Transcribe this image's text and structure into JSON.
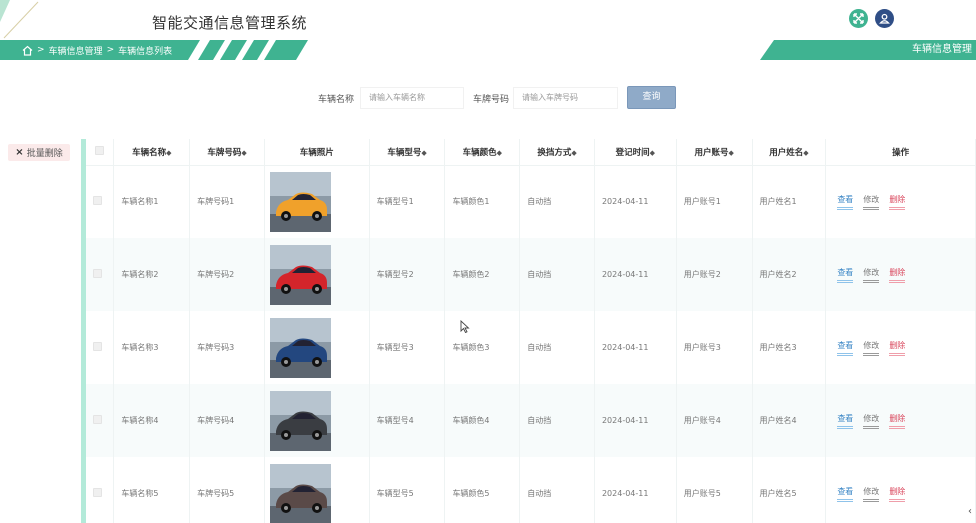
{
  "header": {
    "app_title": "智能交通信息管理系统",
    "breadcrumb": [
      "车辆信息管理",
      "车辆信息列表"
    ],
    "right_banner": "车辆信息管理",
    "icons": [
      "fullscreen-icon",
      "user-icon"
    ],
    "accent_color": "#3fb391"
  },
  "search": {
    "fields": [
      {
        "label": "车辆名称",
        "placeholder": "请输入车辆名称"
      },
      {
        "label": "车牌号码",
        "placeholder": "请输入车牌号码"
      }
    ],
    "button": "查询"
  },
  "toolbar": {
    "batch_delete": "批量删除"
  },
  "table": {
    "columns": [
      {
        "label": "车辆名称",
        "sortable": true
      },
      {
        "label": "车牌号码",
        "sortable": true
      },
      {
        "label": "车辆照片",
        "sortable": false
      },
      {
        "label": "车辆型号",
        "sortable": true
      },
      {
        "label": "车辆颜色",
        "sortable": true
      },
      {
        "label": "换挡方式",
        "sortable": true
      },
      {
        "label": "登记时间",
        "sortable": true
      },
      {
        "label": "用户账号",
        "sortable": true
      },
      {
        "label": "用户姓名",
        "sortable": true
      },
      {
        "label": "操作",
        "sortable": false
      }
    ],
    "sort_symbol": "◆",
    "actions": {
      "view": "查看",
      "edit": "修改",
      "delete": "删除"
    },
    "rows": [
      {
        "name": "车辆名称1",
        "plate": "车牌号码1",
        "photo_color": "#f0a12b",
        "model": "车辆型号1",
        "color": "车辆颜色1",
        "gear": "自动挡",
        "date": "2024-04-11",
        "account": "用户账号1",
        "user": "用户姓名1"
      },
      {
        "name": "车辆名称2",
        "plate": "车牌号码2",
        "photo_color": "#d4252b",
        "model": "车辆型号2",
        "color": "车辆颜色2",
        "gear": "自动挡",
        "date": "2024-04-11",
        "account": "用户账号2",
        "user": "用户姓名2"
      },
      {
        "name": "车辆名称3",
        "plate": "车牌号码3",
        "photo_color": "#23477f",
        "model": "车辆型号3",
        "color": "车辆颜色3",
        "gear": "自动挡",
        "date": "2024-04-11",
        "account": "用户账号3",
        "user": "用户姓名3"
      },
      {
        "name": "车辆名称4",
        "plate": "车牌号码4",
        "photo_color": "#3a3d42",
        "model": "车辆型号4",
        "color": "车辆颜色4",
        "gear": "自动挡",
        "date": "2024-04-11",
        "account": "用户账号4",
        "user": "用户姓名4"
      },
      {
        "name": "车辆名称5",
        "plate": "车牌号码5",
        "photo_color": "#5a4a48",
        "model": "车辆型号5",
        "color": "车辆颜色5",
        "gear": "自动挡",
        "date": "2024-04-11",
        "account": "用户账号5",
        "user": "用户姓名5"
      }
    ]
  }
}
